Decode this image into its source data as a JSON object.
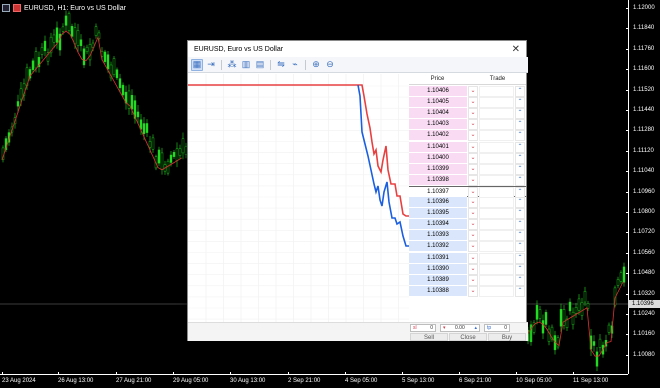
{
  "chart": {
    "title": "EURUSD, H1: Euro vs US Dollar",
    "icons": [
      "window-menu-icon",
      "candle-icon"
    ],
    "current_price": "1.10396",
    "price_axis": [
      "1.12000",
      "1.11840",
      "1.11760",
      "1.11600",
      "1.11520",
      "1.11440",
      "1.11280",
      "1.11120",
      "1.11040",
      "1.10960",
      "1.10800",
      "1.10720",
      "1.10560",
      "1.10480",
      "1.10320",
      "1.10240",
      "1.10160",
      "1.10080"
    ],
    "time_axis": [
      "23 Aug 2024",
      "26 Aug 13:00",
      "27 Aug 21:00",
      "29 Aug 05:00",
      "30 Aug 13:00",
      "2 Sep 21:00",
      "4 Sep 05:00",
      "5 Sep 13:00",
      "6 Sep 21:00",
      "10 Sep 05:00",
      "11 Sep 13:00"
    ],
    "colors": {
      "candle": "#22dd22",
      "ma_line": "#dd3333",
      "background": "#000000"
    }
  },
  "dom": {
    "title": "EURUSD, Euro vs US Dollar",
    "close_icon": "close-icon",
    "toolbar": [
      {
        "icon": "layout-icon",
        "active": true
      },
      {
        "icon": "arrow-right-icon",
        "active": false
      },
      {
        "sep": true
      },
      {
        "icon": "tick-chart-icon",
        "active": false
      },
      {
        "icon": "depth-icon",
        "active": false
      },
      {
        "icon": "volume-icon",
        "active": false
      },
      {
        "sep": true
      },
      {
        "icon": "spread-icon",
        "active": false
      },
      {
        "icon": "filter-icon",
        "active": false
      },
      {
        "sep": true
      },
      {
        "icon": "zoom-in-icon",
        "active": false
      },
      {
        "icon": "zoom-out-icon",
        "active": false
      }
    ],
    "headers": {
      "price": "Price",
      "trade": "Trade"
    },
    "ask_rows": [
      "1.10406",
      "1.10405",
      "1.10404",
      "1.10403",
      "1.10402",
      "1.10401",
      "1.10400",
      "1.10399",
      "1.10398"
    ],
    "last_row": "1.10397",
    "bid_rows": [
      "1.10396",
      "1.10395",
      "1.10394",
      "1.10393",
      "1.10392",
      "1.10391",
      "1.10390",
      "1.10389",
      "1.10388"
    ],
    "footer": {
      "sl_label": "sl",
      "sl_value": "0",
      "volume_value": "0.00",
      "tp_label": "tp",
      "tp_value": "0",
      "sell": "Sell",
      "close": "Close",
      "buy": "Buy"
    },
    "colors": {
      "ask_line": "#e84040",
      "bid_line": "#1a5fe0",
      "ask_bg": "#f9dcf3",
      "bid_bg": "#d9e6fb"
    }
  }
}
